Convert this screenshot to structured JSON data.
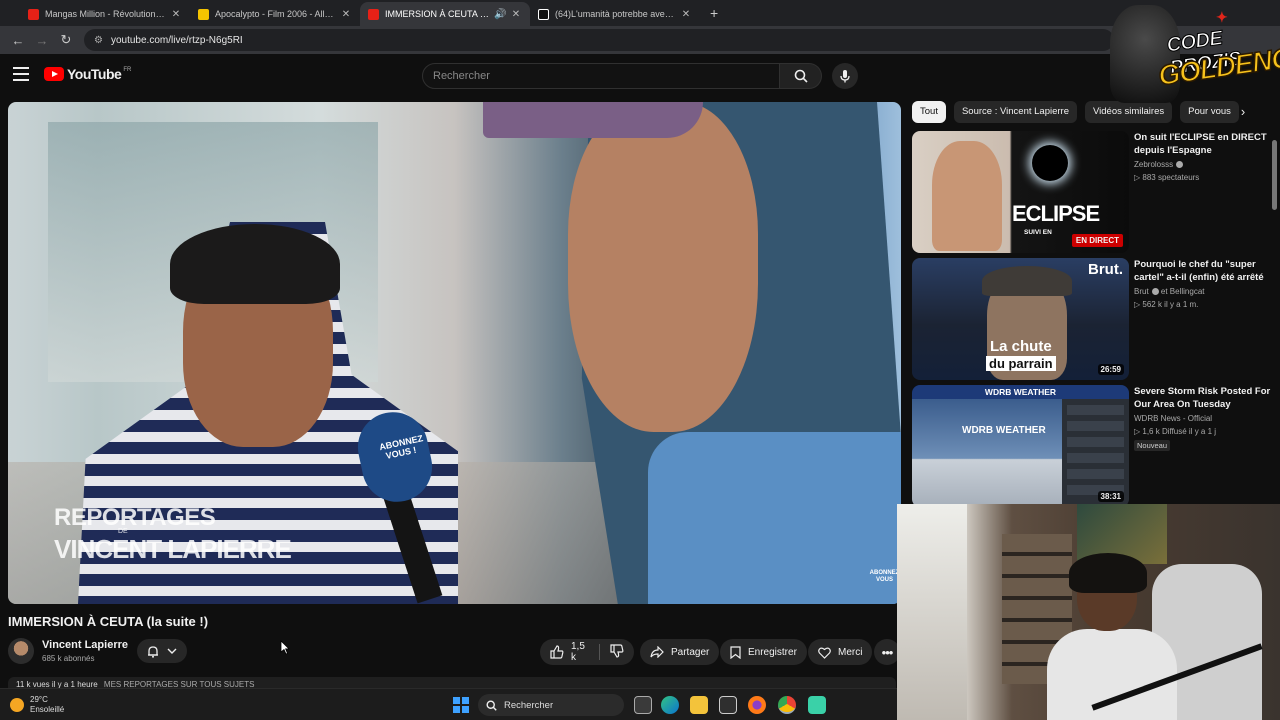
{
  "browser": {
    "tabs": [
      {
        "title": "Mangas Million - Révolution de",
        "favicon_color": "#e62117",
        "active": false
      },
      {
        "title": "Apocalypto - Film 2006 - AlloCi",
        "favicon_color": "#f5c400",
        "active": false
      },
      {
        "title": "IMMERSION À CEUTA (la sui",
        "favicon_color": "#e62117",
        "active": true
      },
      {
        "title": "(64)L'umanità potrebbe aver ap",
        "favicon_color": "#ffffff",
        "active": false
      }
    ],
    "url": "youtube.com/live/rtzp-N6g5RI"
  },
  "youtube": {
    "logo_text": "YouTube",
    "country_code": "FR",
    "search_placeholder": "Rechercher"
  },
  "video": {
    "watermark_top": "REPORTAGES",
    "watermark_de": "DE",
    "watermark_name": "VINCENT LAPIERRE",
    "mic_text": "ABONNEZ VOUS !",
    "corner_text": "ABONNEZ VOUS",
    "title": "IMMERSION À CEUTA (la suite !)"
  },
  "channel": {
    "name": "Vincent Lapierre",
    "subscribers": "685 k abonnés"
  },
  "actions": {
    "likes": "1,5 k",
    "share": "Partager",
    "save": "Enregistrer",
    "thanks": "Merci"
  },
  "description": {
    "meta": "11 k vues  il y a 1 heure",
    "snippet": "MES REPORTAGES SUR TOUS SUJETS"
  },
  "chips": [
    "Tout",
    "Source : Vincent Lapierre",
    "Vidéos similaires",
    "Pour vous"
  ],
  "recommendations": [
    {
      "title": "On suit l'ECLIPSE en DIRECT depuis l'Espagne",
      "channel": "Zebrolosss",
      "meta": "883 spectateurs",
      "thumb_big": "ECLIPSE",
      "thumb_small": "SUIVI EN",
      "badge": "EN DIRECT"
    },
    {
      "title": "Pourquoi le chef du \"super cartel\" a-t-il (enfin) été arrêté",
      "channel": "Brut",
      "channel_extra": "et Bellingcat",
      "meta": "562 k  il y a 1 m.",
      "thumb_brand": "Brut.",
      "thumb_line1": "La chute",
      "thumb_line2": "du parrain",
      "duration": "26:59"
    },
    {
      "title": "Severe Storm Risk Posted For Our Area On Tuesday",
      "channel": "WDRB News - Official",
      "meta": "1,6 k  Diffusé il y a 1 j",
      "badge": "Nouveau",
      "thumb_band": "WDRB WEATHER",
      "thumb_inner": "WDRB WEATHER",
      "duration": "38:31"
    }
  ],
  "overlay_logo": {
    "line1": "CODE PROZIS",
    "line2": "GOLDENG"
  },
  "taskbar": {
    "temperature": "29°C",
    "condition": "Ensoleillé",
    "search": "Rechercher"
  }
}
